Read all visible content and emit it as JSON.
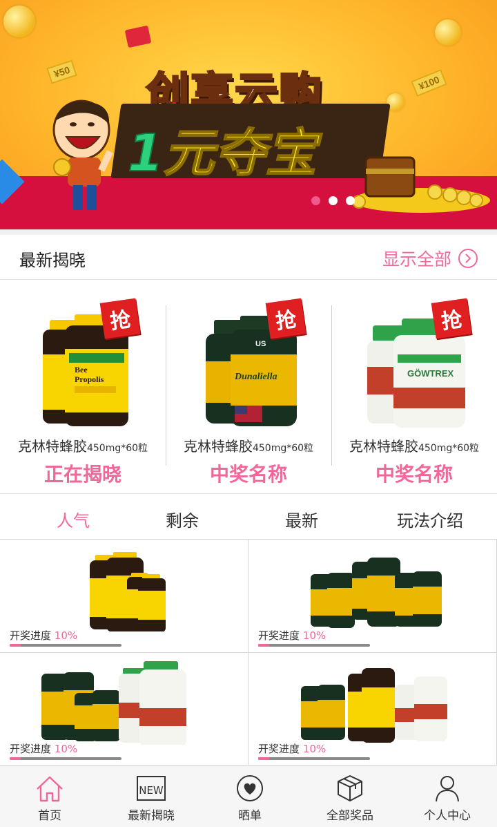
{
  "banner": {
    "title_top": "创享云购",
    "title_bottom_prefix": "1",
    "title_bottom_suffix": "元夺宝",
    "money_left": "¥50",
    "money_right": "¥100",
    "slides": 3,
    "active_slide": 0
  },
  "latest": {
    "title": "最新揭晓",
    "show_all": "显示全部",
    "items": [
      {
        "name": "克林特蜂胶",
        "spec": "450mg*60粒",
        "badge": "抢",
        "status": "正在揭晓",
        "image": "bee-propolis-bottles"
      },
      {
        "name": "克林特蜂胶",
        "spec": "450mg*60粒",
        "badge": "抢",
        "status": "中奖名称",
        "image": "dunaliella-bottles"
      },
      {
        "name": "克林特蜂胶",
        "spec": "450mg*60粒",
        "badge": "抢",
        "status": "中奖名称",
        "image": "gowtrex-bottles"
      }
    ]
  },
  "tabs": [
    {
      "label": "人气",
      "active": true
    },
    {
      "label": "剩余",
      "active": false
    },
    {
      "label": "最新",
      "active": false
    },
    {
      "label": "玩法介绍",
      "active": false
    }
  ],
  "grid": [
    {
      "progress_label": "开奖进度",
      "progress": "10%",
      "progress_value": 0.1,
      "image": "bee-propolis-group"
    },
    {
      "progress_label": "开奖进度",
      "progress": "10%",
      "progress_value": 0.1,
      "image": "dunaliella-group"
    },
    {
      "progress_label": "开奖进度",
      "progress": "10%",
      "progress_value": 0.1,
      "image": "dunaliella-gowtrex-group"
    },
    {
      "progress_label": "开奖进度",
      "progress": "10%",
      "progress_value": 0.1,
      "image": "mixed-group"
    }
  ],
  "bottom_nav": [
    {
      "label": "首页",
      "icon": "home-icon",
      "active": true
    },
    {
      "label": "最新揭晓",
      "icon": "new-icon",
      "active": false
    },
    {
      "label": "晒单",
      "icon": "heart-icon",
      "active": false
    },
    {
      "label": "全部奖品",
      "icon": "box-icon",
      "active": false
    },
    {
      "label": "个人中心",
      "icon": "user-icon",
      "active": false
    }
  ],
  "colors": {
    "accent": "#f0679a",
    "banner_red": "#d6103e",
    "banner_yellow": "#ffc12e",
    "badge_red": "#e02020"
  }
}
